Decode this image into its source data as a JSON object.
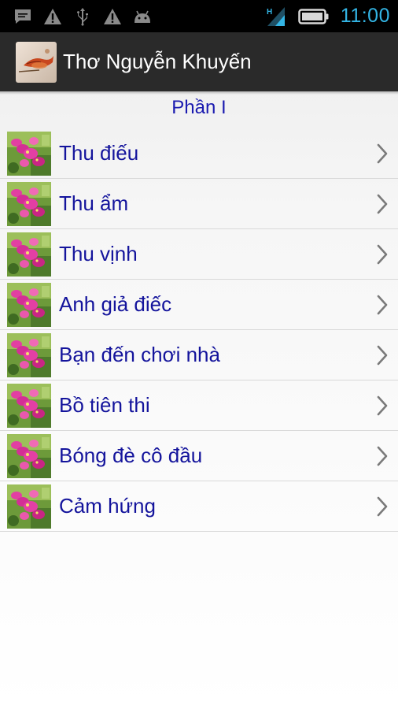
{
  "status_bar": {
    "left_icons": [
      "message-icon",
      "warning-icon",
      "usb-icon",
      "warning-icon",
      "android-icon"
    ],
    "right_icons": [
      "signal-icon",
      "battery-icon"
    ],
    "signal_label": "H",
    "time": "11:00",
    "accent_color": "#33b5e5"
  },
  "action_bar": {
    "title": "Thơ Nguyễn Khuyến",
    "icon": "app-logo-icon"
  },
  "section": {
    "title": "Phần I",
    "color": "#1a1ab0"
  },
  "list": {
    "items": [
      {
        "label": "Thu điếu"
      },
      {
        "label": "Thu ẩm"
      },
      {
        "label": "Thu vịnh"
      },
      {
        "label": "Anh giả điếc"
      },
      {
        "label": "Bạn đến chơi nhà"
      },
      {
        "label": "Bồ tiên thi"
      },
      {
        "label": "Bóng đè cô đầu"
      },
      {
        "label": "Cảm hứng"
      }
    ],
    "item_thumbnail": "flower-thumbnail-icon",
    "item_chevron": "chevron-right-icon",
    "label_color": "#14149c"
  }
}
